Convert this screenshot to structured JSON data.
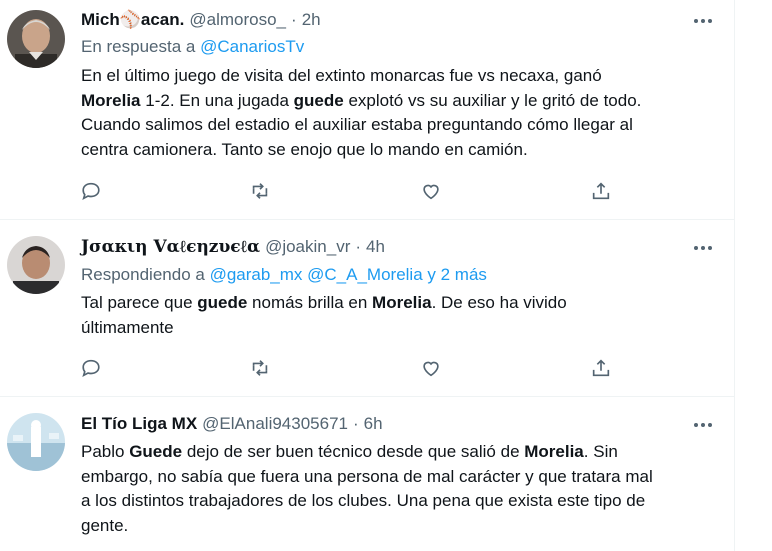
{
  "tweets": [
    {
      "name": "Mich⚾acan.",
      "handle": "@almoroso_",
      "dot": "·",
      "time": "2h",
      "reply_prefix": "En respuesta a",
      "reply_to": "@CanariosTv",
      "text": {
        "l1": "En el último juego de visita del extinto monarcas fue vs necaxa, ganó",
        "l2a": "Morelia",
        "l2b": " 1-2. En una jugada ",
        "l2c": "guede",
        "l2d": " explotó vs su auxiliar y le gritó de todo.",
        "l3": "Cuando salimos del estadio el auxiliar estaba preguntando cómo llegar al",
        "l4": "centra camionera. Tanto se enojo que lo mando en camión."
      }
    },
    {
      "name": "Jσαкιη Vαℓєηzυєℓα",
      "handle": "@joakin_vr",
      "dot": "·",
      "time": "4h",
      "reply_prefix": "Respondiendo a",
      "reply_to": "@garab_mx @C_A_Morelia y 2 más",
      "text": {
        "l1a": "Tal parece que ",
        "l1b": "guede",
        "l1c": " nomás brilla en ",
        "l1d": "Morelia",
        "l1e": ". De eso ha vivido",
        "l2": "últimamente"
      }
    },
    {
      "name": "El Tío Liga MX",
      "handle": "@ElAnali94305671",
      "dot": "·",
      "time": "6h",
      "text": {
        "l1a": "Pablo ",
        "l1b": "Guede",
        "l1c": " dejo de ser buen técnico desde que salió de ",
        "l1d": "Morelia",
        "l1e": ". Sin",
        "l2": "embargo, no sabía que fuera una persona de mal carácter y que tratara mal",
        "l3": "a los distintos trabajadores de los clubes. Una pena que exista este tipo de",
        "l4": "gente."
      }
    }
  ],
  "icons": {
    "reply": "reply-icon",
    "retweet": "retweet-icon",
    "like": "like-icon",
    "share": "share-icon",
    "more": "more-icon"
  },
  "colors": {
    "text": "#0f1419",
    "secondary": "#536471",
    "link": "#1d9bf0",
    "divider": "#eff3f4"
  }
}
